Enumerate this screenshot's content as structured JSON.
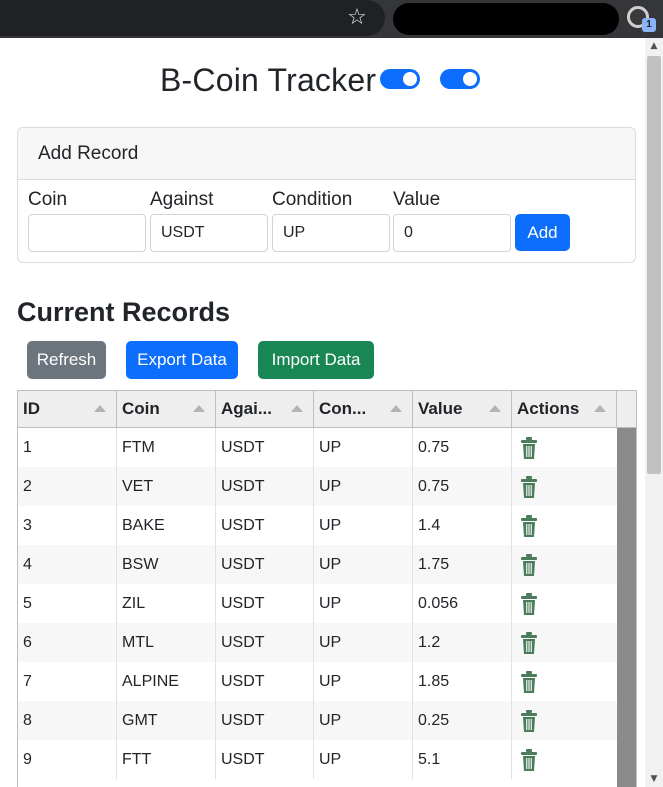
{
  "page": {
    "title": "B-Coin Tracker",
    "toggles": [
      {
        "state": "on"
      },
      {
        "state": "on"
      }
    ]
  },
  "add_record": {
    "header": "Add Record",
    "fields": [
      {
        "label": "Coin",
        "value": ""
      },
      {
        "label": "Against",
        "value": "USDT"
      },
      {
        "label": "Condition",
        "value": "UP"
      },
      {
        "label": "Value",
        "value": "0"
      }
    ],
    "add_label": "Add"
  },
  "records": {
    "heading": "Current Records",
    "refresh_label": "Refresh",
    "export_label": "Export Data",
    "import_label": "Import Data",
    "columns": [
      "ID",
      "Coin",
      "Agai...",
      "Con...",
      "Value",
      "Actions"
    ],
    "rows": [
      {
        "id": "1",
        "coin": "FTM",
        "against": "USDT",
        "condition": "UP",
        "value": "0.75"
      },
      {
        "id": "2",
        "coin": "VET",
        "against": "USDT",
        "condition": "UP",
        "value": "0.75"
      },
      {
        "id": "3",
        "coin": "BAKE",
        "against": "USDT",
        "condition": "UP",
        "value": "1.4"
      },
      {
        "id": "4",
        "coin": "BSW",
        "against": "USDT",
        "condition": "UP",
        "value": "1.75"
      },
      {
        "id": "5",
        "coin": "ZIL",
        "against": "USDT",
        "condition": "UP",
        "value": "0.056"
      },
      {
        "id": "6",
        "coin": "MTL",
        "against": "USDT",
        "condition": "UP",
        "value": "1.2"
      },
      {
        "id": "7",
        "coin": "ALPINE",
        "against": "USDT",
        "condition": "UP",
        "value": "1.85"
      },
      {
        "id": "8",
        "coin": "GMT",
        "against": "USDT",
        "condition": "UP",
        "value": "0.25"
      },
      {
        "id": "9",
        "coin": "FTT",
        "against": "USDT",
        "condition": "UP",
        "value": "5.1"
      }
    ]
  },
  "browser": {
    "extension_badge": "1"
  },
  "colors": {
    "primary": "#0d6efd",
    "secondary": "#6c757d",
    "success": "#198754",
    "trash": "#4a7c59"
  }
}
